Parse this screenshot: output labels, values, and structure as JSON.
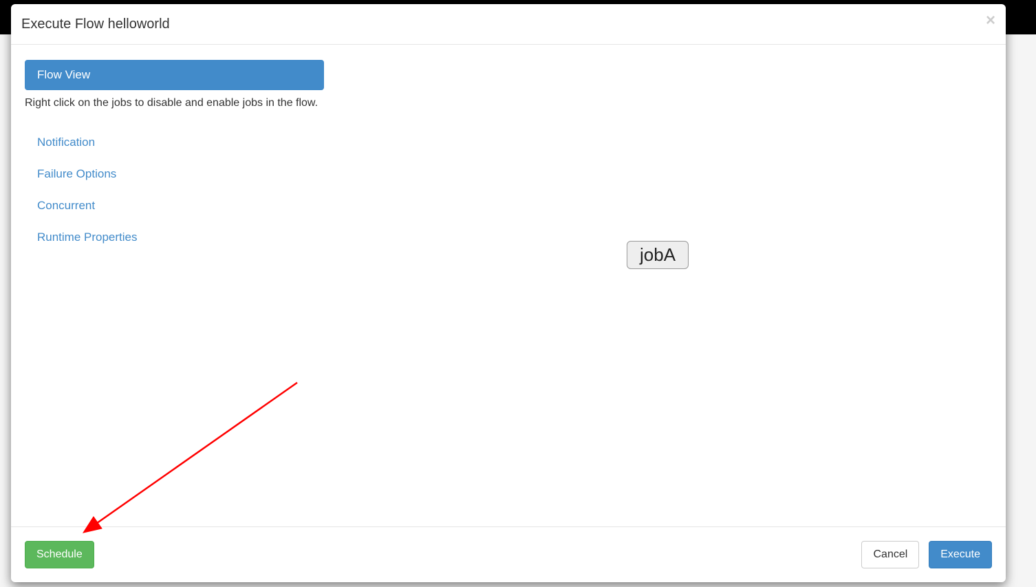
{
  "modal": {
    "title": "Execute Flow helloworld",
    "close": "×"
  },
  "sidebar": {
    "flow_view": {
      "label": "Flow View",
      "hint": "Right click on the jobs to disable and enable jobs in the flow."
    },
    "items": [
      {
        "label": "Notification"
      },
      {
        "label": "Failure Options"
      },
      {
        "label": "Concurrent"
      },
      {
        "label": "Runtime Properties"
      }
    ]
  },
  "canvas": {
    "jobs": [
      {
        "name": "jobA"
      }
    ]
  },
  "footer": {
    "schedule": "Schedule",
    "cancel": "Cancel",
    "execute": "Execute"
  }
}
